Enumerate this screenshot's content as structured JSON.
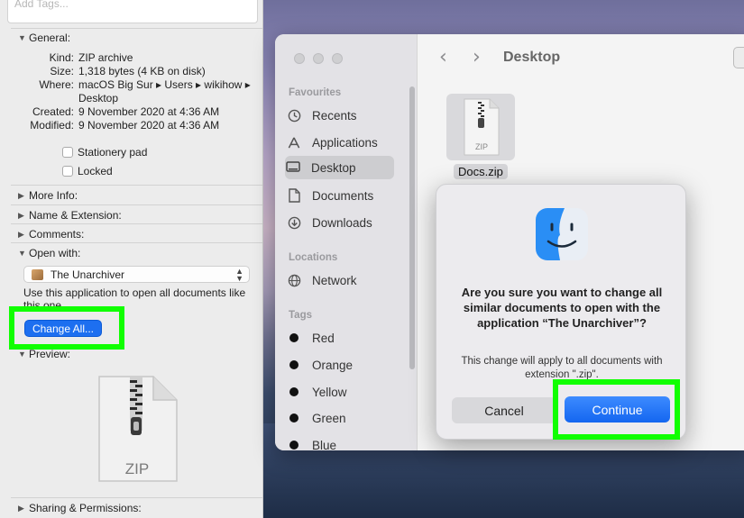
{
  "info_panel": {
    "tags_placeholder": "Add Tags...",
    "general": {
      "label": "General:",
      "rows": [
        {
          "key": "Kind:",
          "value": "ZIP archive"
        },
        {
          "key": "Size:",
          "value": "1,318 bytes (4 KB on disk)"
        },
        {
          "key": "Where:",
          "value": "macOS Big Sur ▸ Users ▸ wikihow ▸ Desktop"
        },
        {
          "key": "Created:",
          "value": "9 November 2020 at 4:36 AM"
        },
        {
          "key": "Modified:",
          "value": "9 November 2020 at 4:36 AM"
        }
      ],
      "stationery_label": "Stationery pad",
      "locked_label": "Locked"
    },
    "more_info": "More Info:",
    "name_extension": "Name & Extension:",
    "comments": "Comments:",
    "open_with": {
      "label": "Open with:",
      "selected_app": "The Unarchiver",
      "description": "Use this application to open all documents like this one.",
      "change_all": "Change All..."
    },
    "preview": {
      "label": "Preview:",
      "icon_text": "ZIP"
    },
    "sharing": "Sharing & Permissions:"
  },
  "finder": {
    "title": "Desktop",
    "favourites_header": "Favourites",
    "favourites": [
      {
        "label": "Recents",
        "icon": "clock-icon"
      },
      {
        "label": "Applications",
        "icon": "applications-icon"
      },
      {
        "label": "Desktop",
        "icon": "desktop-icon",
        "selected": true
      },
      {
        "label": "Documents",
        "icon": "document-icon"
      },
      {
        "label": "Downloads",
        "icon": "download-icon"
      }
    ],
    "locations_header": "Locations",
    "locations": [
      {
        "label": "Network",
        "icon": "network-icon"
      }
    ],
    "tags_header": "Tags",
    "tags": [
      "Red",
      "Orange",
      "Yellow",
      "Green",
      "Blue"
    ],
    "file": {
      "name": "Docs.zip",
      "icon_text": "ZIP"
    }
  },
  "dialog": {
    "title": "Are you sure you want to change all similar documents to open with the application “The Unarchiver”?",
    "message": "This change will apply to all documents with extension \".zip\".",
    "cancel": "Cancel",
    "continue": "Continue"
  },
  "colors": {
    "highlight": "#10ff00",
    "accent": "#1d6ff0"
  }
}
